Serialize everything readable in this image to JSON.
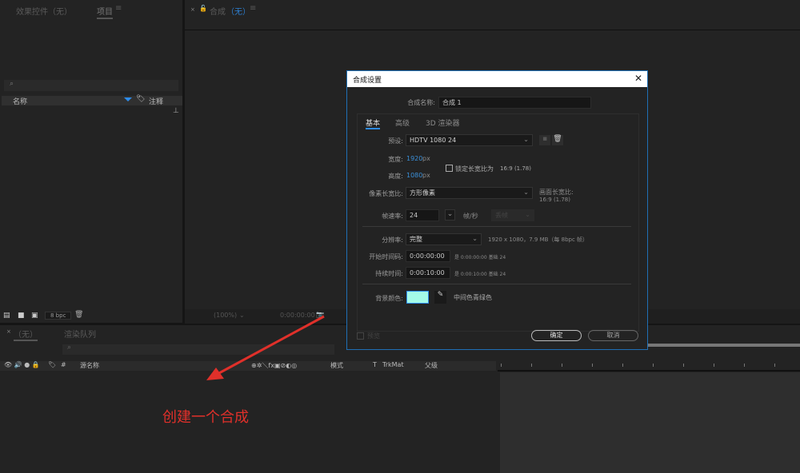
{
  "left_panel": {
    "tab_effects": "效果控件（无）",
    "tab_project": "项目",
    "menu_icon": "≡",
    "search_placeholder": "",
    "col_name": "名称",
    "col_comment": "注释",
    "bpc": "8 bpc"
  },
  "comp_panel": {
    "tab_label": "合成",
    "tab_value": "（无）",
    "zoom": "(100%)",
    "timecode": "0:00:00:00"
  },
  "timeline": {
    "tab_label": "（无）",
    "tab_render": "渲染队列",
    "col_hash": "#",
    "col_source": "源名称",
    "col_mode": "模式",
    "col_t": "T",
    "col_trkmat": "TrkMat",
    "col_parent": "父级"
  },
  "dialog": {
    "title": "合成设置",
    "close": "✕",
    "name_label": "合成名称:",
    "name_value": "合成 1",
    "tabs": [
      "基本",
      "高级",
      "3D 渲染器"
    ],
    "preset_label": "预设:",
    "preset_value": "HDTV 1080 24",
    "width_label": "宽度:",
    "width_value": "1920",
    "height_label": "高度:",
    "height_value": "1080",
    "px": "px",
    "lock_label": "锁定长宽比为",
    "lock_ratio": "16:9 (1.78)",
    "lock_checked": false,
    "par_label": "像素长宽比:",
    "par_value": "方形像素",
    "frame_ar_label": "画面长宽比:",
    "frame_ar_value": "16:9 (1.78)",
    "fps_label": "帧速率:",
    "fps_value": "24",
    "fps_unit": "帧/秒",
    "drop_value": "丢帧",
    "res_label": "分辨率:",
    "res_value": "完整",
    "res_info": "1920 x 1080，7.9 MB（每 8bpc 帧）",
    "start_label": "开始时间码:",
    "start_value": "0:00:00:00",
    "start_info": "是 0:00:00:00  基础 24",
    "dur_label": "持续时间:",
    "dur_value": "0:00:10:00",
    "dur_info": "是 0:00:10:00  基础 24",
    "bg_label": "背景颜色:",
    "bg_color": "#a4fbe8",
    "bg_name": "中间色青绿色",
    "preview_label": "预览",
    "ok": "确定",
    "cancel": "取消"
  },
  "annotation": {
    "text": "创建一个合成",
    "color": "#e0302a"
  }
}
